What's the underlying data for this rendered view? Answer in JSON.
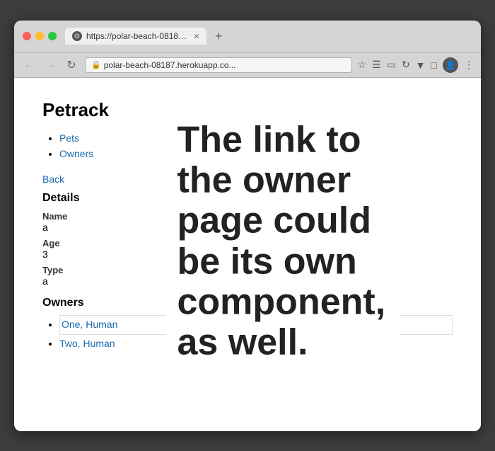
{
  "browser": {
    "tab_url": "https://polar-beach-08187.he...",
    "tab_url_full": "https://polar-beach-08187.herokuapp.co...",
    "address_bar_text": "polar-beach-08187.herokuapp.co...",
    "tab_close_label": "×",
    "new_tab_label": "+"
  },
  "nav": {
    "back_label": "Back",
    "pets_link": "Pets",
    "owners_link": "Owners"
  },
  "app": {
    "title": "Petrack"
  },
  "detail": {
    "section_label": "Details",
    "name_label": "Name",
    "name_value": "a",
    "age_label": "Age",
    "age_value": "3",
    "type_label": "Type",
    "type_value": "a"
  },
  "owners": {
    "section_label": "Owners",
    "items": [
      {
        "label": "One, Human",
        "href": "#",
        "highlighted": true
      },
      {
        "label": "Two, Human",
        "href": "#",
        "highlighted": false
      }
    ]
  },
  "tooltip": {
    "text": "The link to the owner page could be its own component, as well."
  }
}
